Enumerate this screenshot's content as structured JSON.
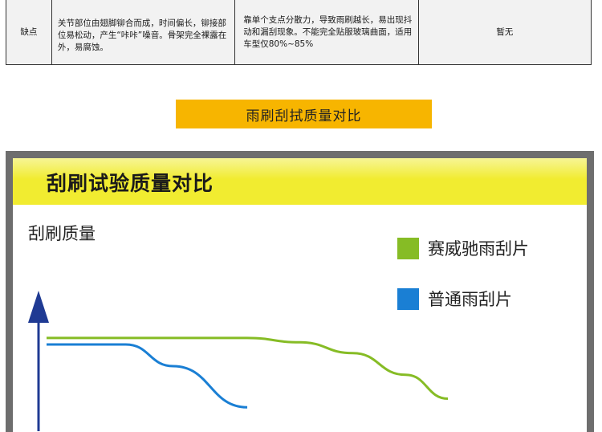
{
  "table": {
    "row_label": "缺点",
    "col1": "关节部位由翅脚铆合而成，时间偏长，铆接部位易松动，产生“咔咔”噪音。骨架完全裸露在外，易腐蚀。",
    "col2": "靠单个支点分散力，导致雨刷越长，易出现抖动和漏刮现象。不能完全贴服玻璃曲面，适用车型仅80%~85%",
    "col3": "暂无"
  },
  "banner": {
    "text": "雨刷刮拭质量对比"
  },
  "chart_card": {
    "title": "刮刷试验质量对比"
  },
  "colors": {
    "banner": "#f7b500",
    "header_yellow": "#f1ec30",
    "series_green": "#86bc25",
    "series_blue": "#1a7fd4",
    "axis": "#1f3a93"
  },
  "chart_data": {
    "type": "line",
    "title": "刮刷试验质量对比",
    "ylabel": "刮刷质量",
    "xlabel": "",
    "legend_position": "right",
    "grid": false,
    "series": [
      {
        "name": "赛威驰雨刮片",
        "color": "#86bc25",
        "points": [
          [
            0,
            86
          ],
          [
            38,
            86
          ],
          [
            48,
            82
          ],
          [
            58,
            72
          ],
          [
            68,
            52
          ],
          [
            76,
            30
          ]
        ]
      },
      {
        "name": "普通雨刮片",
        "color": "#1a7fd4",
        "points": [
          [
            0,
            80
          ],
          [
            15,
            80
          ],
          [
            24,
            60
          ],
          [
            38,
            22
          ]
        ]
      }
    ],
    "xlim": [
      0,
      100
    ],
    "ylim": [
      0,
      100
    ]
  }
}
